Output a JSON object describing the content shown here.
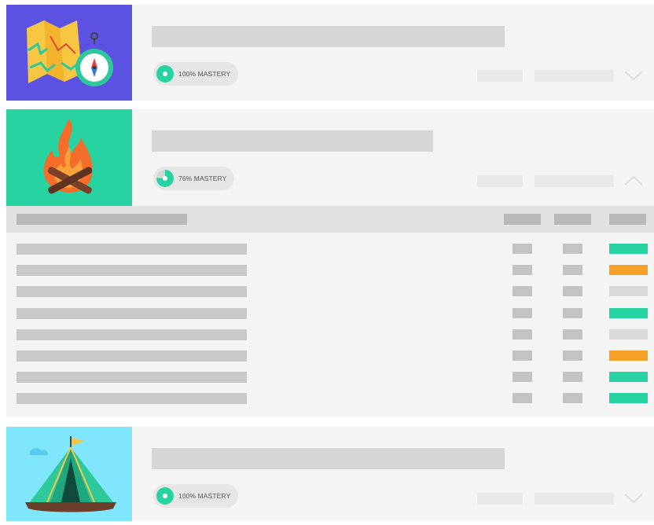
{
  "units": [
    {
      "illustration": "map-compass",
      "background": "#5b52e1",
      "mastery_label": "100% MASTERY",
      "mastery_fraction": 1.0,
      "mastery_color": "#27d3a1",
      "expanded": false,
      "toggle_icon": "chevron-down-icon"
    },
    {
      "illustration": "campfire",
      "background": "#27d3a1",
      "mastery_label": "76% MASTERY",
      "mastery_fraction": 0.76,
      "mastery_color": "#27d3a1",
      "expanded": true,
      "toggle_icon": "chevron-up-icon"
    },
    {
      "illustration": "tent",
      "background": "#7fe6fb",
      "mastery_label": "100% MASTERY",
      "mastery_fraction": 1.0,
      "mastery_color": "#27d3a1",
      "expanded": false,
      "toggle_icon": "chevron-down-icon"
    }
  ],
  "lesson_rows": [
    {
      "status_color": "#27d3a1"
    },
    {
      "status_color": "#f4a126"
    },
    {
      "status_color": "#d9d9d9"
    },
    {
      "status_color": "#27d3a1"
    },
    {
      "status_color": "#d9d9d9"
    },
    {
      "status_color": "#f4a126"
    },
    {
      "status_color": "#27d3a1"
    },
    {
      "status_color": "#27d3a1"
    }
  ],
  "colors": {
    "accent_green": "#27d3a1",
    "accent_orange": "#f4a126",
    "placeholder": "#d6d6d7"
  }
}
